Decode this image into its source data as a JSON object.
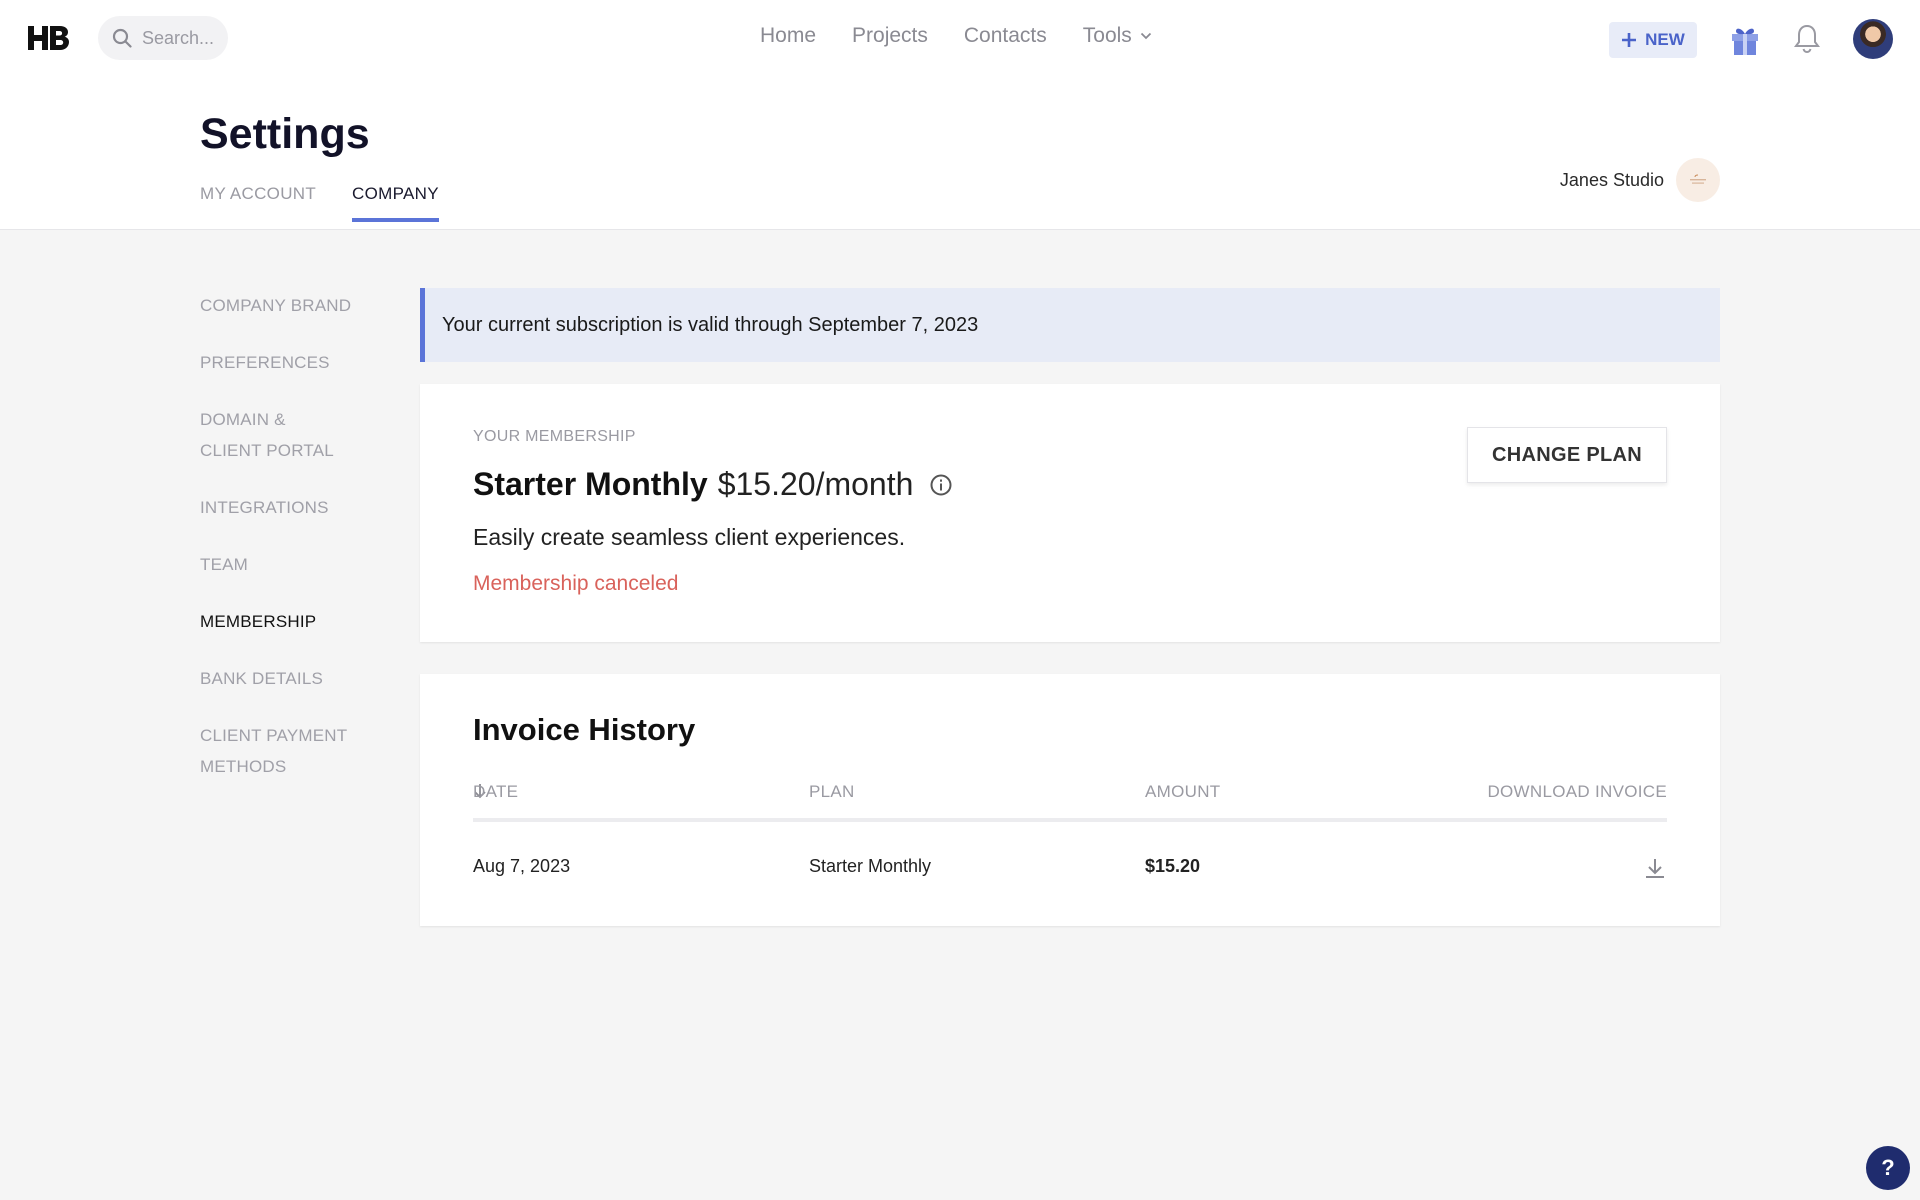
{
  "topnav": {
    "search_placeholder": "Search...",
    "links": [
      "Home",
      "Projects",
      "Contacts",
      "Tools"
    ],
    "new_label": "NEW"
  },
  "header": {
    "title": "Settings",
    "tabs": [
      "MY ACCOUNT",
      "COMPANY"
    ],
    "active_tab": "COMPANY",
    "company_name": "Janes Studio"
  },
  "sidebar": {
    "items": [
      {
        "label": "COMPANY BRAND"
      },
      {
        "label": "PREFERENCES"
      },
      {
        "label": "DOMAIN &\nCLIENT PORTAL"
      },
      {
        "label": "INTEGRATIONS"
      },
      {
        "label": "TEAM"
      },
      {
        "label": "MEMBERSHIP"
      },
      {
        "label": "BANK DETAILS"
      },
      {
        "label": "CLIENT PAYMENT\nMETHODS"
      }
    ],
    "active": "MEMBERSHIP"
  },
  "banner": {
    "text": "Your current subscription is valid through September 7, 2023"
  },
  "membership": {
    "label": "YOUR MEMBERSHIP",
    "plan_name": "Starter Monthly",
    "price": "$15.20/month",
    "description": "Easily create seamless client experiences.",
    "status": "Membership canceled",
    "change_plan_label": "CHANGE PLAN"
  },
  "invoices": {
    "title": "Invoice History",
    "columns": [
      "DATE",
      "PLAN",
      "AMOUNT",
      "DOWNLOAD INVOICE"
    ],
    "rows": [
      {
        "date": "Aug 7, 2023",
        "plan": "Starter Monthly",
        "amount": "$15.20"
      }
    ]
  },
  "help_label": "?",
  "colors": {
    "accent": "#5b74d8",
    "banner_bg": "#e7ebf6",
    "canceled": "#d9625b",
    "help_bg": "#1f2c6e"
  }
}
